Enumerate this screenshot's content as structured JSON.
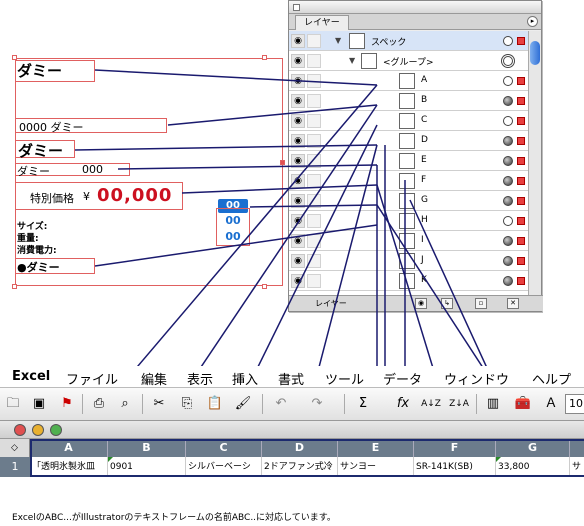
{
  "artboard": {
    "dummy1": "ダミー",
    "dummy_code": "0000 ダミー",
    "dummy2": "ダミー",
    "dummy3": "ダミー",
    "dummy3_code": "000",
    "special_label": "特別価格",
    "special_currency": "¥",
    "price": "00,000",
    "badge": "00",
    "blue1": "00",
    "blue2": "00",
    "spec_size": "サイズ:",
    "spec_weight": "重量:",
    "spec_power": "消費電力:",
    "bullet_dummy": "●ダミー"
  },
  "layers_palette": {
    "tab": "レイヤー",
    "menu_icon": "palette-menu-icon",
    "footer_label": "レイヤー",
    "layers": [
      {
        "name": "スペック",
        "selected": true,
        "expanded": true,
        "indent": 0,
        "target": "hollow"
      },
      {
        "name": "<グループ>",
        "selected": false,
        "expanded": true,
        "indent": 1,
        "target": "double"
      },
      {
        "name": "A",
        "selected": false,
        "indent": 2,
        "target": "hollow"
      },
      {
        "name": "B",
        "selected": false,
        "indent": 2,
        "target": "filled"
      },
      {
        "name": "C",
        "selected": false,
        "indent": 2,
        "target": "hollow"
      },
      {
        "name": "D",
        "selected": false,
        "indent": 2,
        "target": "filled"
      },
      {
        "name": "E",
        "selected": false,
        "indent": 2,
        "target": "filled"
      },
      {
        "name": "F",
        "selected": false,
        "indent": 2,
        "target": "filled"
      },
      {
        "name": "G",
        "selected": false,
        "indent": 2,
        "target": "filled"
      },
      {
        "name": "H",
        "selected": false,
        "indent": 2,
        "target": "hollow"
      },
      {
        "name": "I",
        "selected": false,
        "indent": 2,
        "target": "filled"
      },
      {
        "name": "J",
        "selected": false,
        "indent": 2,
        "target": "filled"
      },
      {
        "name": "K",
        "selected": false,
        "indent": 2,
        "target": "filled"
      }
    ],
    "accent_color": "#e84040"
  },
  "excel": {
    "menu": [
      "Excel",
      "ファイル",
      "編集",
      "表示",
      "挿入",
      "書式",
      "ツール",
      "データ",
      "ウィンドウ",
      "ヘルプ"
    ],
    "zoom_value": "10",
    "corner_symbol": "◇",
    "columns": [
      "A",
      "B",
      "C",
      "D",
      "E",
      "F",
      "G"
    ],
    "row_number": "1",
    "row_values": [
      "「透明氷製氷皿",
      "0901",
      "シルバーベーシ",
      "2ドアファン式冷",
      "サンヨー",
      "SR-141K(SB)",
      "33,800",
      "サ"
    ],
    "header_color": "#6c7c8c"
  },
  "caption": "ExcelのABC...がIllustratorのテキストフレームの名前ABC..に対応しています。"
}
